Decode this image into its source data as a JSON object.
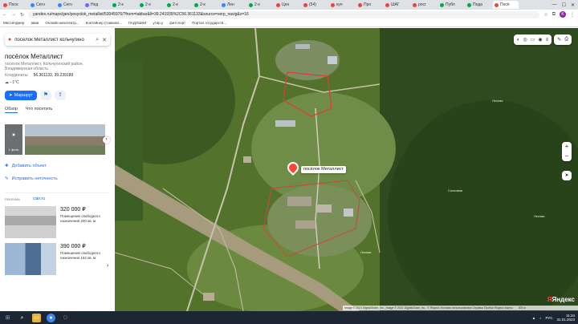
{
  "browser": {
    "tabs": [
      {
        "label": "Посе",
        "color": "#e8453c",
        "active": false
      },
      {
        "label": "Сегн",
        "color": "#3e86f5",
        "active": false
      },
      {
        "label": "Сегн",
        "color": "#3e86f5",
        "active": false
      },
      {
        "label": "Нед",
        "color": "#7b61ff",
        "active": false
      },
      {
        "label": "2-к",
        "color": "#00a650",
        "active": false
      },
      {
        "label": "2-к",
        "color": "#00a650",
        "active": false
      },
      {
        "label": "2-к",
        "color": "#00a650",
        "active": false
      },
      {
        "label": "2-к",
        "color": "#00a650",
        "active": false
      },
      {
        "label": "Лен",
        "color": "#3e86f5",
        "active": false
      },
      {
        "label": "2-к",
        "color": "#00a650",
        "active": false
      },
      {
        "label": "Цен",
        "color": "#e8453c",
        "active": false
      },
      {
        "label": "(54)",
        "color": "#e8453c",
        "active": false
      },
      {
        "label": "кул",
        "color": "#e8453c",
        "active": false
      },
      {
        "label": "Про",
        "color": "#e8453c",
        "active": false
      },
      {
        "label": "ШАГ",
        "color": "#e8453c",
        "active": false
      },
      {
        "label": "росг",
        "color": "#e8453c",
        "active": false
      },
      {
        "label": "Публ",
        "color": "#00a650",
        "active": false
      },
      {
        "label": "Пода",
        "color": "#00a650",
        "active": false
      },
      {
        "label": "Посё",
        "color": "#e8453c",
        "active": true
      }
    ],
    "url": "yandex.ru/maps/geo/posyolok_metallist/53045976/?from=tabbar&ll=39.241939%2C56.361133&source=serp_navig&z=16",
    "bookmarks": [
      "Мессенджер",
      "авиа",
      "Онлайн-кинотеатр...",
      "Контейнер (главная...",
      "ЛАДОШКИ",
      "утир.у",
      "фитспорт",
      "Портал государств..."
    ],
    "avatar_letter": "K"
  },
  "sidebar": {
    "search_value": "посёлок Металлист кольчугино",
    "title": "посёлок Металлист",
    "address": "посёлок Металлист, Кольчугинский район, Владимирская область",
    "coords_label": "Координаты:",
    "coords_value": "56.361133, 39.239189",
    "weather": "−1°C",
    "route_label": "Маршрут",
    "tabs": [
      "Обзор",
      "Что посетить"
    ],
    "photo_count": "1 фото",
    "add_object": "Добавить объект",
    "fix_error": "Исправить неточность",
    "ads_label": "РЕКЛАМА",
    "ads_brand": "cian.ru",
    "ads": [
      {
        "price": "320 000 ₽",
        "desc": "Помещение свободного назначения 200 кв. м"
      },
      {
        "price": "390 000 ₽",
        "desc": "Помещение свободного назначения 162 кв. м"
      }
    ]
  },
  "map": {
    "place_label": "посёлок Металлист",
    "watermark": "Яндекс",
    "copyright": "Image © 2021 DigitalGlobe, Inc., Image © 2021 DigitalGlobe, Inc., © Яндекс  Условия использования   Справка   Пробки   Яндекс.Карты",
    "scale": "300 м",
    "road_labels": [
      "Лесная",
      "Лесная",
      "Лесная",
      "Сосновая"
    ]
  },
  "taskbar": {
    "lang": "РУС",
    "time": "11:34",
    "date": "31.01.2023"
  }
}
